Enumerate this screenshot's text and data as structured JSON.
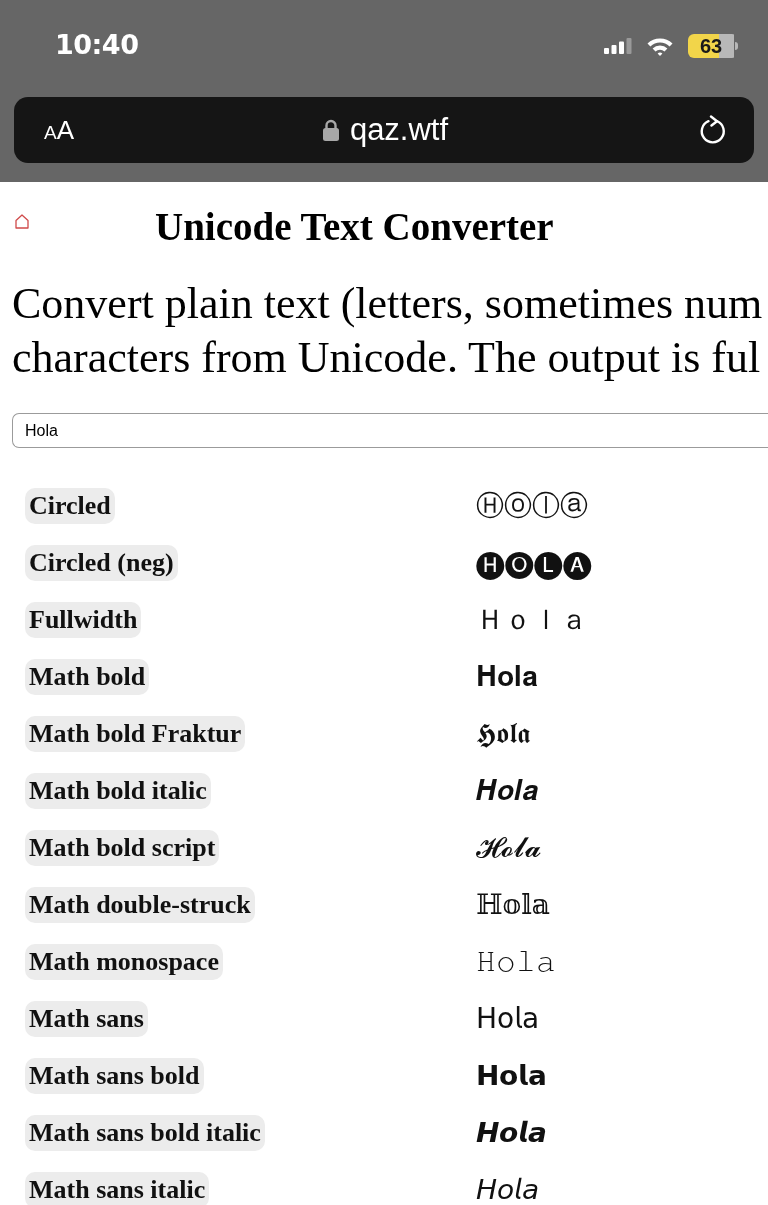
{
  "status_bar": {
    "time": "10:40",
    "battery": "63"
  },
  "address_bar": {
    "text_size_button": {
      "small": "A",
      "large": "A"
    },
    "url": "qaz.wtf"
  },
  "page": {
    "title": "Unicode Text Converter",
    "intro_lines": [
      "Convert plain text (letters, sometimes num",
      "characters from Unicode. The output is ful"
    ],
    "input": {
      "value": "Hola"
    },
    "styles": [
      {
        "name": "Circled",
        "output": "Ⓗⓞⓛⓐ"
      },
      {
        "name": "Circled (neg)",
        "output": "🅗🅞🅛🅐"
      },
      {
        "name": "Fullwidth",
        "output": "Ｈｏｌａ"
      },
      {
        "name": "Math bold",
        "output": "𝐇𝐨𝐥𝐚"
      },
      {
        "name": "Math bold Fraktur",
        "output": "𝕳𝖔𝖑𝖆"
      },
      {
        "name": "Math bold italic",
        "output": "𝑯𝒐𝒍𝒂"
      },
      {
        "name": "Math bold script",
        "output": "𝓗𝓸𝓵𝓪"
      },
      {
        "name": "Math double-struck",
        "output": "ℍ𝕠𝕝𝕒"
      },
      {
        "name": "Math monospace",
        "output": "𝙷𝚘𝚕𝚊"
      },
      {
        "name": "Math sans",
        "output": "𝖧𝗈𝗅𝖺"
      },
      {
        "name": "Math sans bold",
        "output": "𝗛𝗼𝗹𝗮"
      },
      {
        "name": "Math sans bold italic",
        "output": "𝙃𝙤𝙡𝙖"
      },
      {
        "name": "Math sans italic",
        "output": "𝘏𝘰𝘭𝘢"
      }
    ]
  }
}
